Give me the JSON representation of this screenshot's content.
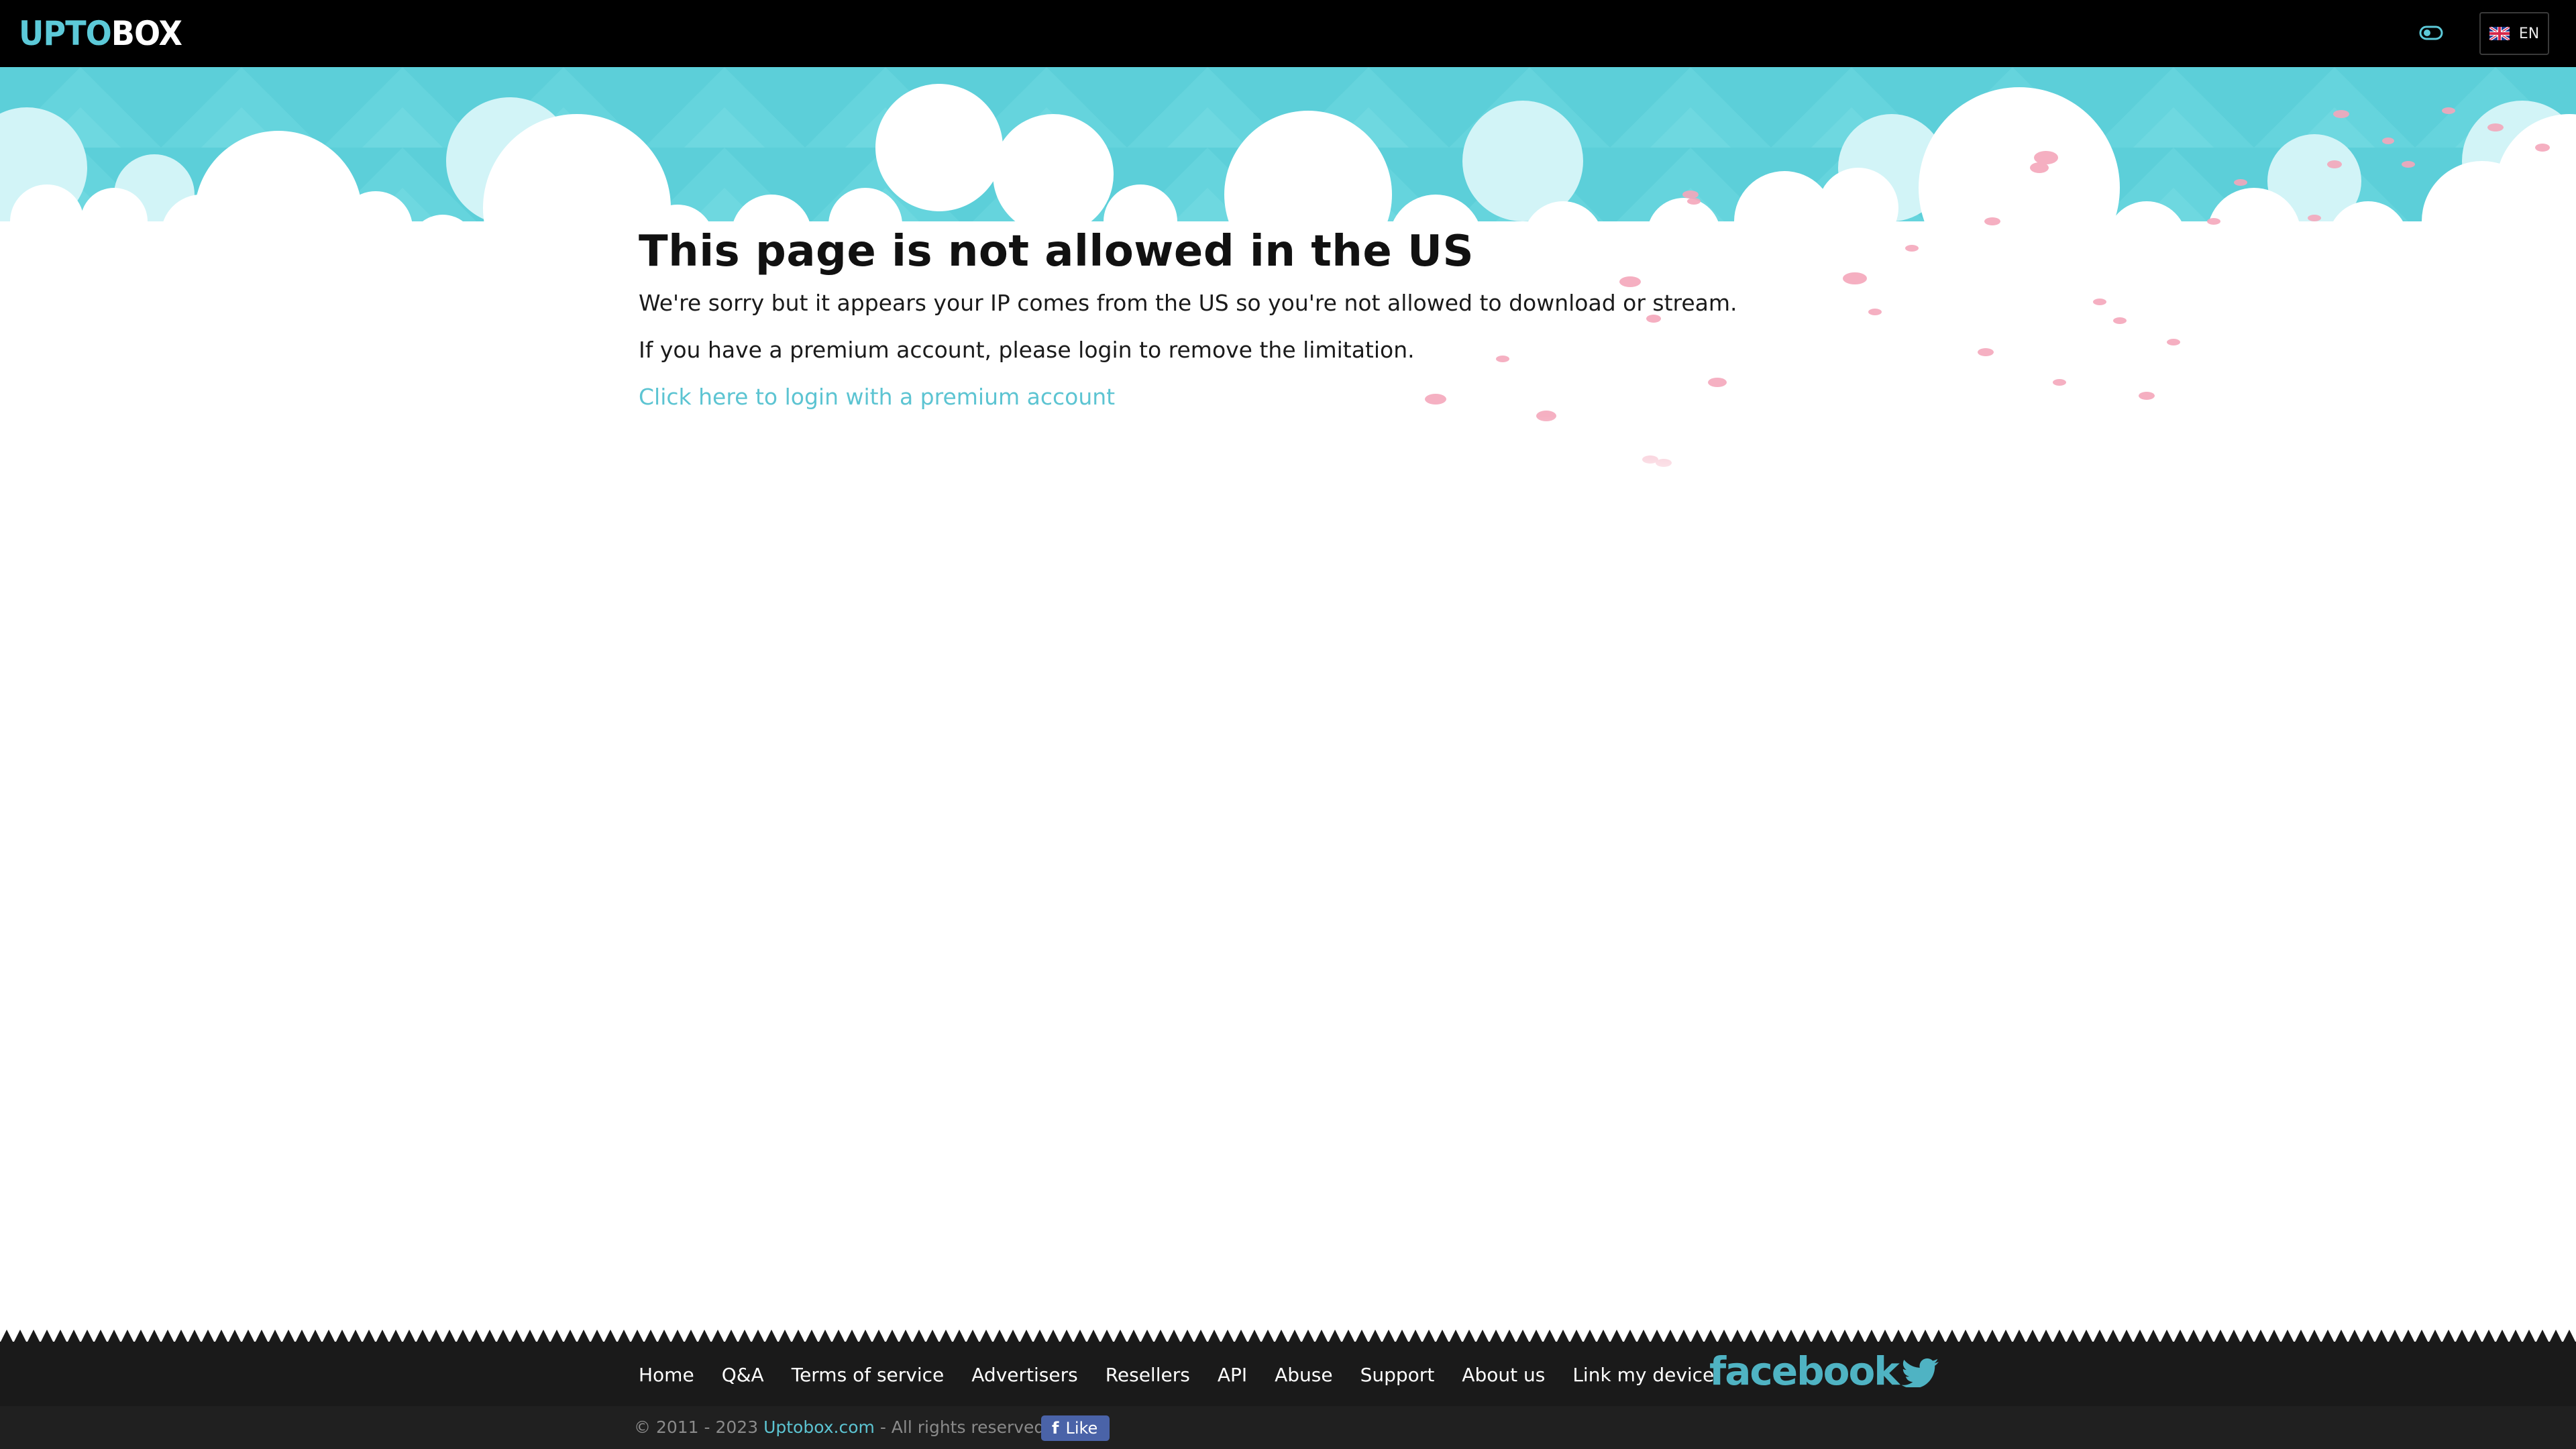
{
  "header": {
    "logo_part1": "UPTO",
    "logo_part2": "BOX",
    "language_label": "EN",
    "icons": {
      "theme_toggle": "toggle-icon",
      "language_flag": "uk-flag-icon"
    }
  },
  "main": {
    "title": "This page is not allowed in the US",
    "message_1": "We're sorry but it appears your IP comes from the US so you're not allowed to download or stream.",
    "message_2": "If you have a premium account, please login to remove the limitation.",
    "login_link": "Click here to login with a premium account"
  },
  "footer": {
    "nav": [
      "Home",
      "Q&A",
      "Terms of service",
      "Advertisers",
      "Resellers",
      "API",
      "Abuse",
      "Support",
      "About us",
      "Link my device"
    ],
    "social_text": "facebook",
    "copyright_prefix": "© 2011 - 2023",
    "site_name": "Uptobox.com",
    "copyright_suffix": "- All rights reserved",
    "like_label": "Like"
  },
  "colors": {
    "accent": "#5cc4d2",
    "sky": "#5ccfd9",
    "topbar": "#000000",
    "footer": "#1a1a1a",
    "petal": "#f4a7bb",
    "like_button": "#4a63a8"
  }
}
